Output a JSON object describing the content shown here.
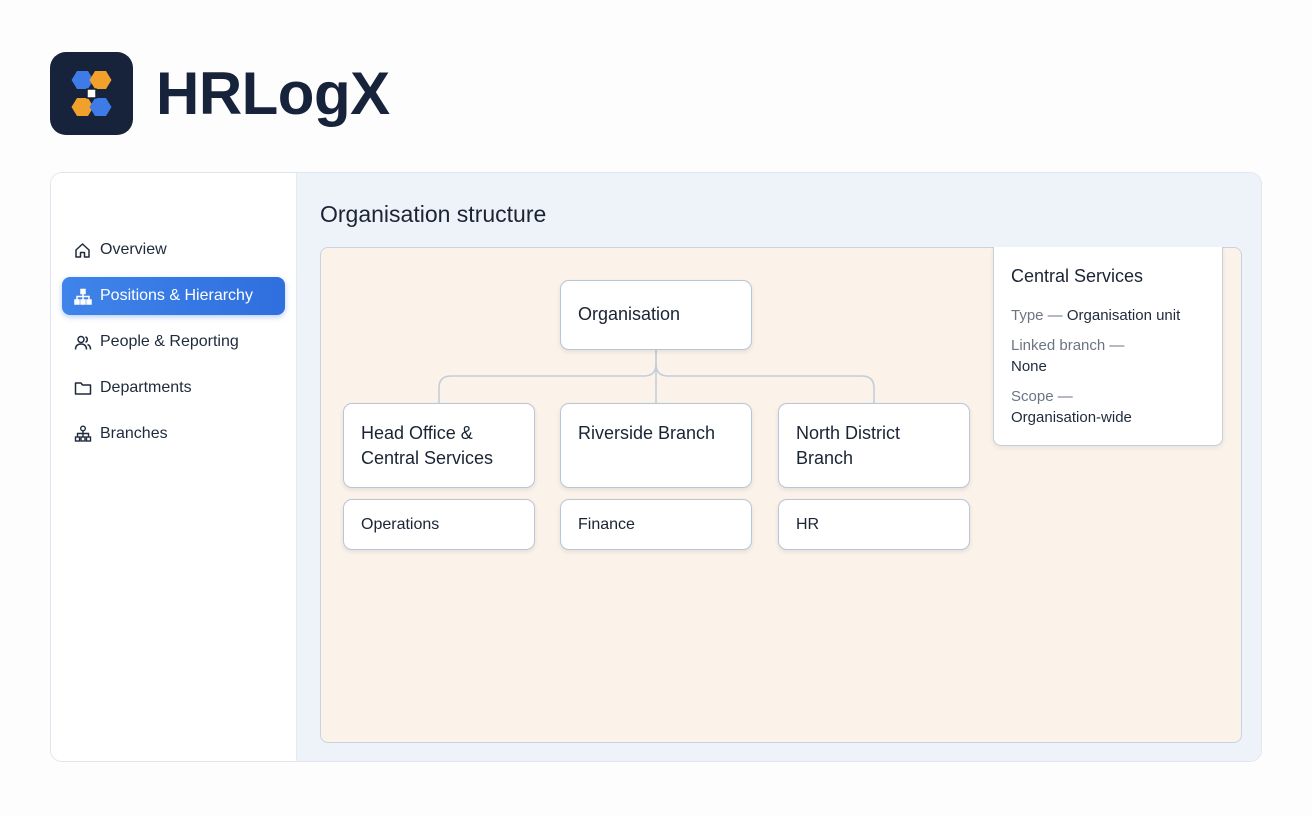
{
  "app": {
    "name": "HRLogX"
  },
  "colors": {
    "accent": "#2f6fde",
    "canvas_bg": "#fbf2e9",
    "logo_orange": "#f2a02c",
    "logo_blue": "#3f7be6",
    "logo_bg": "#17233a"
  },
  "sidebar": {
    "items": [
      {
        "label": "Overview",
        "icon": "home-icon",
        "active": false
      },
      {
        "label": "Positions & Hierarchy",
        "icon": "hierarchy-icon",
        "active": true
      },
      {
        "label": "People & Reporting",
        "icon": "people-icon",
        "active": false
      },
      {
        "label": "Departments",
        "icon": "folder-icon",
        "active": false
      },
      {
        "label": "Branches",
        "icon": "branches-icon",
        "active": false
      }
    ]
  },
  "main": {
    "title": "Organisation structure",
    "tree": {
      "root": "Organisation",
      "branches": [
        {
          "label": "Head Office & Central Services",
          "department": "Operations"
        },
        {
          "label": "Riverside Branch",
          "department": "Finance"
        },
        {
          "label": "North District Branch",
          "department": "HR"
        }
      ]
    },
    "detail": {
      "title": "Central Services",
      "type_label": "Type —",
      "type_value": "Organisation unit",
      "linked_label": "Linked branch —",
      "linked_value": "None",
      "scope_label": "Scope —",
      "scope_value": "Organisation-wide"
    }
  }
}
